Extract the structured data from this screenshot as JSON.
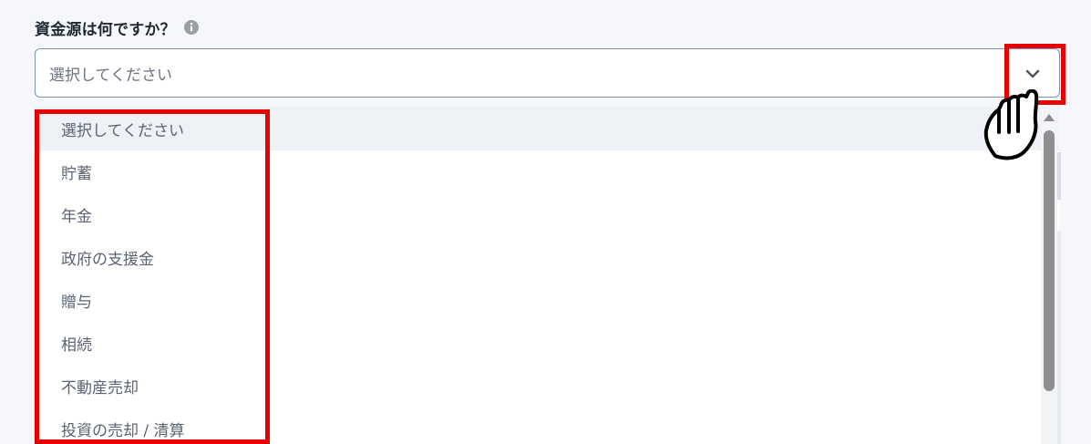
{
  "question": {
    "label": "資金源は何ですか？",
    "info_icon": "info-icon"
  },
  "select": {
    "value": "選択してください",
    "chevron_icon": "chevron-down-icon"
  },
  "dropdown": {
    "options": [
      {
        "label": "選択してください"
      },
      {
        "label": "貯蓄"
      },
      {
        "label": "年金"
      },
      {
        "label": "政府の支援金"
      },
      {
        "label": "贈与"
      },
      {
        "label": "相続"
      },
      {
        "label": "不動産売却"
      },
      {
        "label": "投資の売却 / 清算"
      }
    ]
  },
  "annotations": {
    "highlight_color": "#e60000",
    "cursor_icon": "hand-pointer-icon"
  }
}
